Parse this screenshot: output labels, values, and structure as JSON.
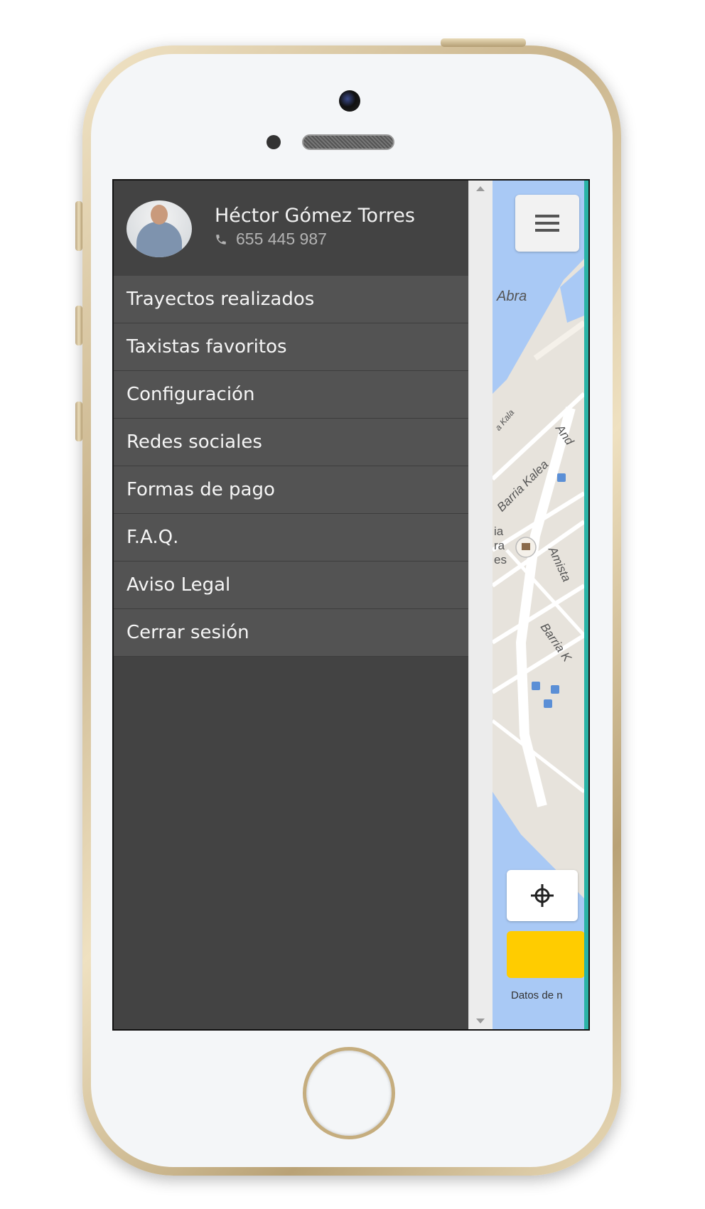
{
  "profile": {
    "name": "Héctor Gómez Torres",
    "phone": "655 445 987"
  },
  "menu": {
    "items": [
      {
        "label": "Trayectos realizados"
      },
      {
        "label": "Taxistas favoritos"
      },
      {
        "label": "Configuración"
      },
      {
        "label": "Redes sociales"
      },
      {
        "label": "Formas de pago"
      },
      {
        "label": "F.A.Q."
      },
      {
        "label": "Aviso Legal"
      },
      {
        "label": "Cerrar sesión"
      }
    ]
  },
  "map": {
    "labels": {
      "abra": "Abra",
      "kala": "a Kala",
      "barria_kalea": "Barria Kalea",
      "and": "And",
      "amista": "Amista",
      "barria_k": "Barria K",
      "ia": "ia",
      "ra": "ra",
      "es": "es"
    },
    "attribution": "Datos de n",
    "icons": {
      "menu": "hamburger-icon",
      "locate": "crosshair-icon",
      "phone": "phone-icon"
    }
  },
  "colors": {
    "drawer": "#434343",
    "menu_item": "#535353",
    "water": "#a9c9f5",
    "accent": "#ffcc00",
    "teal": "#2ab3a6"
  }
}
